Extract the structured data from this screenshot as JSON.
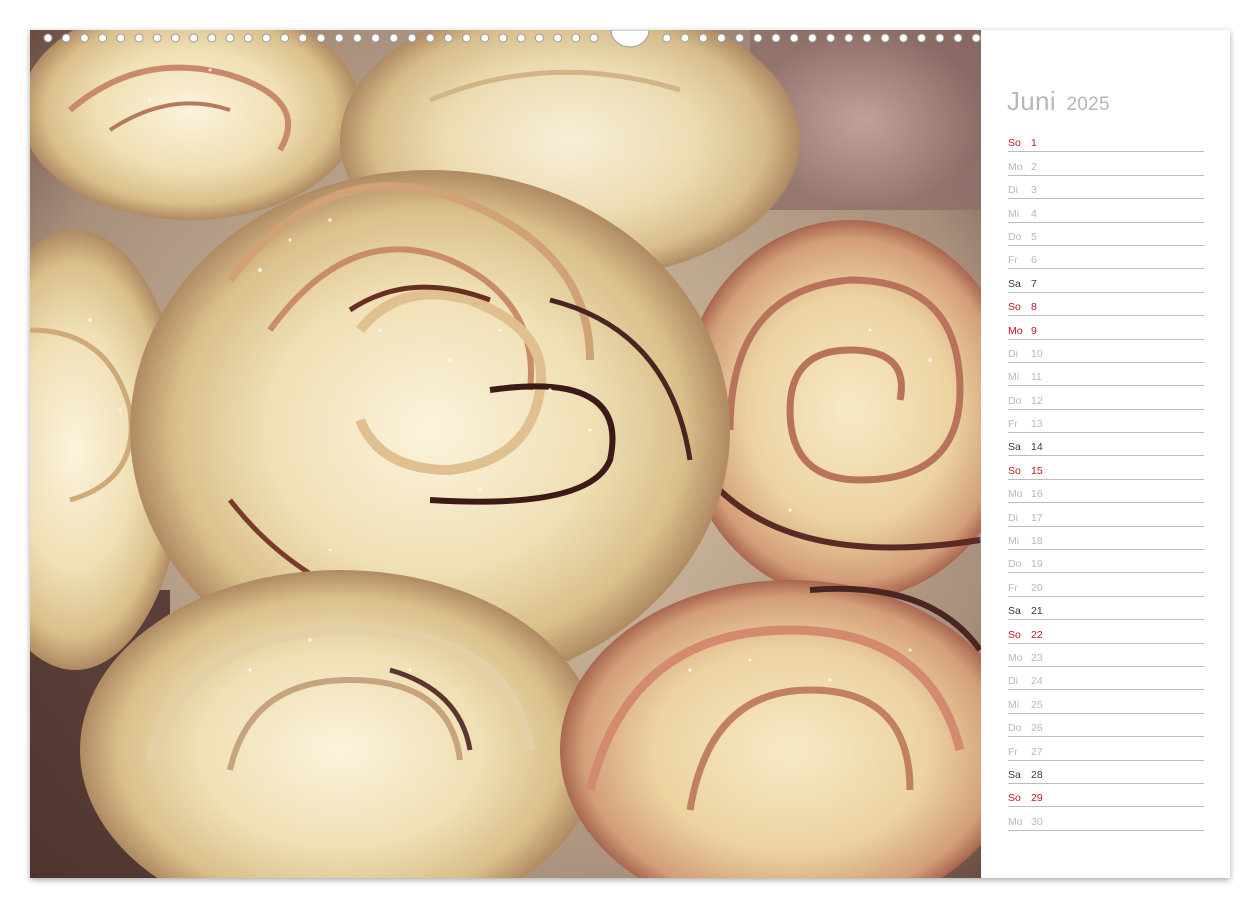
{
  "calendar": {
    "month": "Juni",
    "year": "2025",
    "days": [
      {
        "weekday": "So",
        "day": "1",
        "kind": "sunday"
      },
      {
        "weekday": "Mo",
        "day": "2",
        "kind": "weekday"
      },
      {
        "weekday": "Di",
        "day": "3",
        "kind": "weekday"
      },
      {
        "weekday": "Mi",
        "day": "4",
        "kind": "weekday"
      },
      {
        "weekday": "Do",
        "day": "5",
        "kind": "weekday"
      },
      {
        "weekday": "Fr",
        "day": "6",
        "kind": "weekday"
      },
      {
        "weekday": "Sa",
        "day": "7",
        "kind": "saturday"
      },
      {
        "weekday": "So",
        "day": "8",
        "kind": "sunday"
      },
      {
        "weekday": "Mo",
        "day": "9",
        "kind": "holiday"
      },
      {
        "weekday": "Di",
        "day": "10",
        "kind": "weekday"
      },
      {
        "weekday": "Mi",
        "day": "11",
        "kind": "weekday"
      },
      {
        "weekday": "Do",
        "day": "12",
        "kind": "weekday"
      },
      {
        "weekday": "Fr",
        "day": "13",
        "kind": "weekday"
      },
      {
        "weekday": "Sa",
        "day": "14",
        "kind": "saturday"
      },
      {
        "weekday": "So",
        "day": "15",
        "kind": "sunday"
      },
      {
        "weekday": "Mo",
        "day": "16",
        "kind": "weekday"
      },
      {
        "weekday": "Di",
        "day": "17",
        "kind": "weekday"
      },
      {
        "weekday": "Mi",
        "day": "18",
        "kind": "weekday"
      },
      {
        "weekday": "Do",
        "day": "19",
        "kind": "weekday"
      },
      {
        "weekday": "Fr",
        "day": "20",
        "kind": "weekday"
      },
      {
        "weekday": "Sa",
        "day": "21",
        "kind": "saturday"
      },
      {
        "weekday": "So",
        "day": "22",
        "kind": "sunday"
      },
      {
        "weekday": "Mo",
        "day": "23",
        "kind": "weekday"
      },
      {
        "weekday": "Di",
        "day": "24",
        "kind": "weekday"
      },
      {
        "weekday": "Mi",
        "day": "25",
        "kind": "weekday"
      },
      {
        "weekday": "Do",
        "day": "26",
        "kind": "weekday"
      },
      {
        "weekday": "Fr",
        "day": "27",
        "kind": "weekday"
      },
      {
        "weekday": "Sa",
        "day": "28",
        "kind": "saturday"
      },
      {
        "weekday": "So",
        "day": "29",
        "kind": "sunday"
      },
      {
        "weekday": "Mo",
        "day": "30",
        "kind": "weekday"
      }
    ]
  },
  "colors": {
    "sunday": "#c0161d",
    "saturday": "#3a3a3a",
    "weekday": "#b8b8b8",
    "title": "#b7b7b7"
  },
  "photo": {
    "subject": "apple-rose-pastries-photo"
  }
}
